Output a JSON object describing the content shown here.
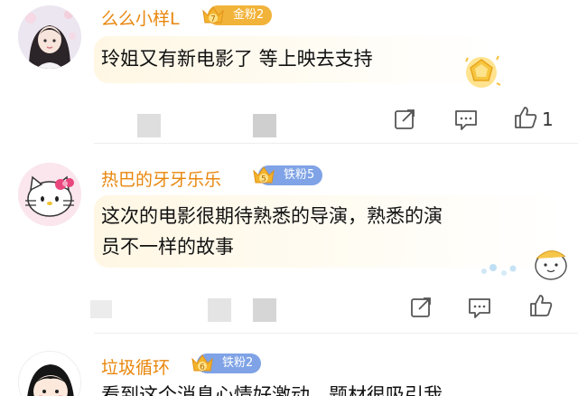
{
  "comments": [
    {
      "username": "么么小样L",
      "badge": {
        "level": "7",
        "label": "金粉2",
        "color": "#f2b33a"
      },
      "text": "玲姐又有新电影了 等上映去支持",
      "likes": "1",
      "avatar_icon": "girl-avatar-icon",
      "sticker_icon": "gold-medal-sticker-icon"
    },
    {
      "username": "热巴的牙牙乐乐",
      "badge": {
        "level": "5",
        "label": "铁粉5",
        "color": "#7fa3e6"
      },
      "text_line1": "这次的电影很期待熟悉的导演，熟悉的演",
      "text_line2": "员不一样的故事",
      "likes": "",
      "avatar_icon": "hello-kitty-avatar-icon",
      "sticker_icon": "cartoon-ghost-sticker-icon"
    },
    {
      "username": "垃圾循环",
      "badge": {
        "level": "6",
        "label": "铁粉2",
        "color": "#7fa3e6"
      },
      "text": "看到这个消息心情好激动，题材很吸引我",
      "avatar_icon": "cartoon-girl-avatar-icon"
    }
  ],
  "actions": {
    "share_icon": "share-icon",
    "comment_icon": "comment-icon",
    "like_icon": "thumbs-up-icon"
  }
}
